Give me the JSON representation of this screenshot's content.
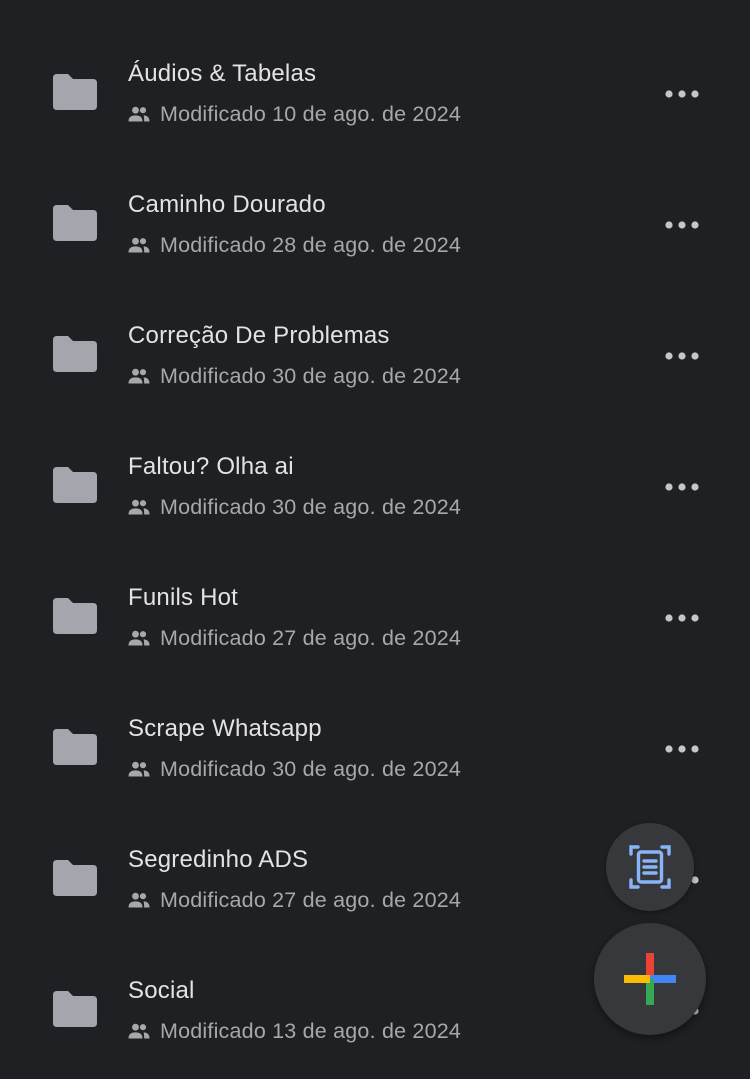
{
  "colors": {
    "background": "#1f2023",
    "title_text": "#e3e3e3",
    "secondary_text": "#a6a8ab",
    "folder_icon": "#a3a7ad",
    "fab_background": "#36383c",
    "scan_icon": "#8ab4f8",
    "plus_red": "#ea4335",
    "plus_blue": "#4285f4",
    "plus_green": "#34a853",
    "plus_yellow": "#fbbc04"
  },
  "files": {
    "items": [
      {
        "name": "Áudios & Tabelas",
        "modified": "Modificado 10 de ago. de 2024",
        "icon": "folder-icon",
        "shared_icon": "people-icon",
        "menu_icon": "more-horizontal-icon"
      },
      {
        "name": "Caminho Dourado",
        "modified": "Modificado 28 de ago. de 2024",
        "icon": "folder-icon",
        "shared_icon": "people-icon",
        "menu_icon": "more-horizontal-icon"
      },
      {
        "name": "Correção De Problemas",
        "modified": "Modificado 30 de ago. de 2024",
        "icon": "folder-icon",
        "shared_icon": "people-icon",
        "menu_icon": "more-horizontal-icon"
      },
      {
        "name": "Faltou? Olha ai",
        "modified": "Modificado 30 de ago. de 2024",
        "icon": "folder-icon",
        "shared_icon": "people-icon",
        "menu_icon": "more-horizontal-icon"
      },
      {
        "name": "Funils Hot",
        "modified": "Modificado 27 de ago. de 2024",
        "icon": "folder-icon",
        "shared_icon": "people-icon",
        "menu_icon": "more-horizontal-icon"
      },
      {
        "name": "Scrape Whatsapp",
        "modified": "Modificado 30 de ago. de 2024",
        "icon": "folder-icon",
        "shared_icon": "people-icon",
        "menu_icon": "more-horizontal-icon"
      },
      {
        "name": "Segredinho ADS",
        "modified": "Modificado 27 de ago. de 2024",
        "icon": "folder-icon",
        "shared_icon": "people-icon",
        "menu_icon": "more-horizontal-icon"
      },
      {
        "name": "Social",
        "modified": "Modificado 13 de ago. de 2024",
        "icon": "folder-icon",
        "shared_icon": "people-icon",
        "menu_icon": "more-horizontal-icon"
      }
    ]
  },
  "fab": {
    "scan_icon": "document-scanner-icon",
    "new_icon": "colorful-plus-icon"
  }
}
